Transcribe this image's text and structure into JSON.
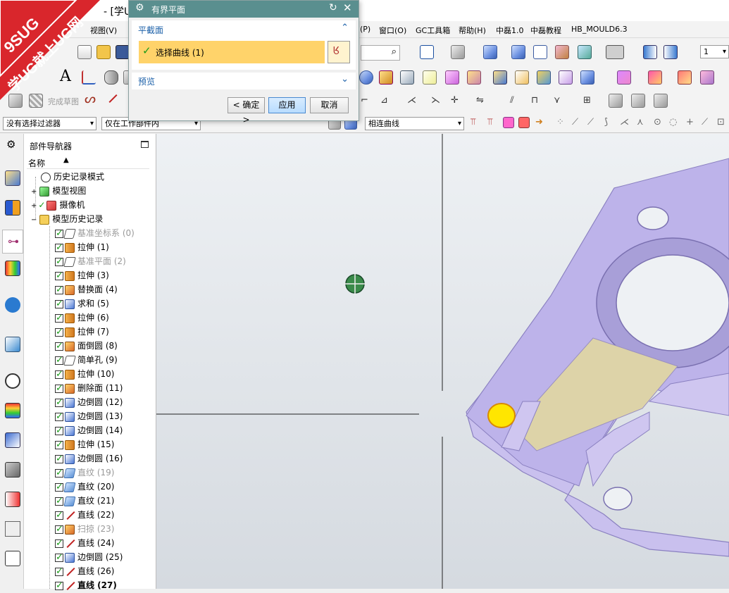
{
  "window": {
    "title_fragment": "- [学U"
  },
  "menu": {
    "items": [
      "视图(V)",
      "(P)",
      "窗口(O)",
      "GC工具箱",
      "帮助(H)",
      "中磊1.0",
      "中磊教程",
      "HB_MOULD6.3"
    ]
  },
  "toolbar": {
    "zoom_value": "1",
    "finish_sketch": "完成草图"
  },
  "filters": {
    "selection_filter": "没有选择过滤器",
    "scope_filter": "仅在工作部件内",
    "curve_rule": "相连曲线"
  },
  "logo": {
    "line1": "9SUG",
    "line2": "学UG就上UG网"
  },
  "dialog": {
    "title": "有界平面",
    "section_label": "平截面",
    "selection_label": "选择曲线 (1)",
    "preview_label": "预览",
    "ok_label": "< 确定 >",
    "apply_label": "应用",
    "cancel_label": "取消"
  },
  "navigator": {
    "title": "部件导航器",
    "column_name": "名称",
    "top_nodes": [
      {
        "label": "历史记录模式"
      },
      {
        "label": "模型视图"
      },
      {
        "label": "摄像机"
      },
      {
        "label": "模型历史记录"
      }
    ],
    "features": [
      {
        "label": "基准坐标系 (0)",
        "icon": "datum-csys-icon",
        "state": "dim"
      },
      {
        "label": "拉伸 (1)",
        "icon": "extrude-icon",
        "state": "normal"
      },
      {
        "label": "基准平面 (2)",
        "icon": "datum-plane-icon",
        "state": "dim"
      },
      {
        "label": "拉伸 (3)",
        "icon": "extrude-icon",
        "state": "normal"
      },
      {
        "label": "替换面 (4)",
        "icon": "replace-face-icon",
        "state": "normal"
      },
      {
        "label": "求和 (5)",
        "icon": "unite-icon",
        "state": "normal"
      },
      {
        "label": "拉伸 (6)",
        "icon": "extrude-icon",
        "state": "normal"
      },
      {
        "label": "拉伸 (7)",
        "icon": "extrude-icon",
        "state": "normal"
      },
      {
        "label": "面倒圆 (8)",
        "icon": "face-blend-icon",
        "state": "normal"
      },
      {
        "label": "简单孔 (9)",
        "icon": "hole-icon",
        "state": "normal"
      },
      {
        "label": "拉伸 (10)",
        "icon": "extrude-icon",
        "state": "normal"
      },
      {
        "label": "删除面 (11)",
        "icon": "delete-face-icon",
        "state": "normal"
      },
      {
        "label": "边倒圆 (12)",
        "icon": "edge-blend-icon",
        "state": "normal"
      },
      {
        "label": "边倒圆 (13)",
        "icon": "edge-blend-icon",
        "state": "normal"
      },
      {
        "label": "边倒圆 (14)",
        "icon": "edge-blend-icon",
        "state": "normal"
      },
      {
        "label": "拉伸 (15)",
        "icon": "extrude-icon",
        "state": "normal"
      },
      {
        "label": "边倒圆 (16)",
        "icon": "edge-blend-icon",
        "state": "normal"
      },
      {
        "label": "直纹 (19)",
        "icon": "ruled-icon",
        "state": "dim"
      },
      {
        "label": "直纹 (20)",
        "icon": "ruled-icon",
        "state": "normal"
      },
      {
        "label": "直纹 (21)",
        "icon": "ruled-icon",
        "state": "normal"
      },
      {
        "label": "直线 (22)",
        "icon": "line-icon",
        "state": "normal"
      },
      {
        "label": "扫掠 (23)",
        "icon": "swept-icon",
        "state": "dim"
      },
      {
        "label": "直线 (24)",
        "icon": "line-icon",
        "state": "normal"
      },
      {
        "label": "边倒圆 (25)",
        "icon": "edge-blend-icon",
        "state": "normal"
      },
      {
        "label": "直线 (26)",
        "icon": "line-icon",
        "state": "normal"
      },
      {
        "label": "直线 (27)",
        "icon": "line-icon",
        "state": "bold"
      }
    ]
  },
  "colors": {
    "dialog_title_bg": "#5a8f8f",
    "selection_highlight": "#ffd36a",
    "part_color": "#b9aee8",
    "highlight_point": "#ffe600"
  }
}
